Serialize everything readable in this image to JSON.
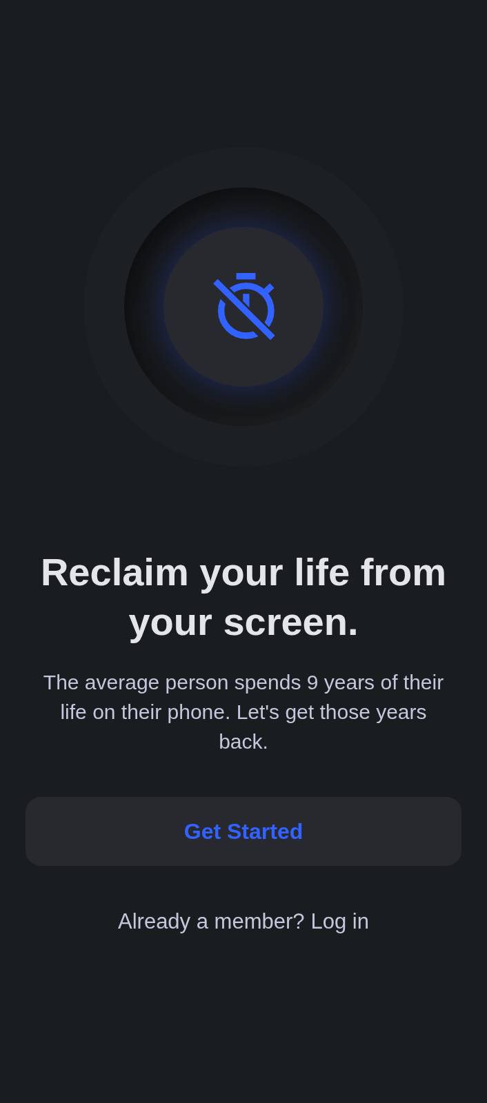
{
  "heading": "Reclaim your life from your screen.",
  "description": "The average person spends 9 years of their life on their phone. Let's get those years back.",
  "primary_button": {
    "label": "Get Started"
  },
  "login_prompt": {
    "text": "Already a member?",
    "link": "Log in"
  }
}
